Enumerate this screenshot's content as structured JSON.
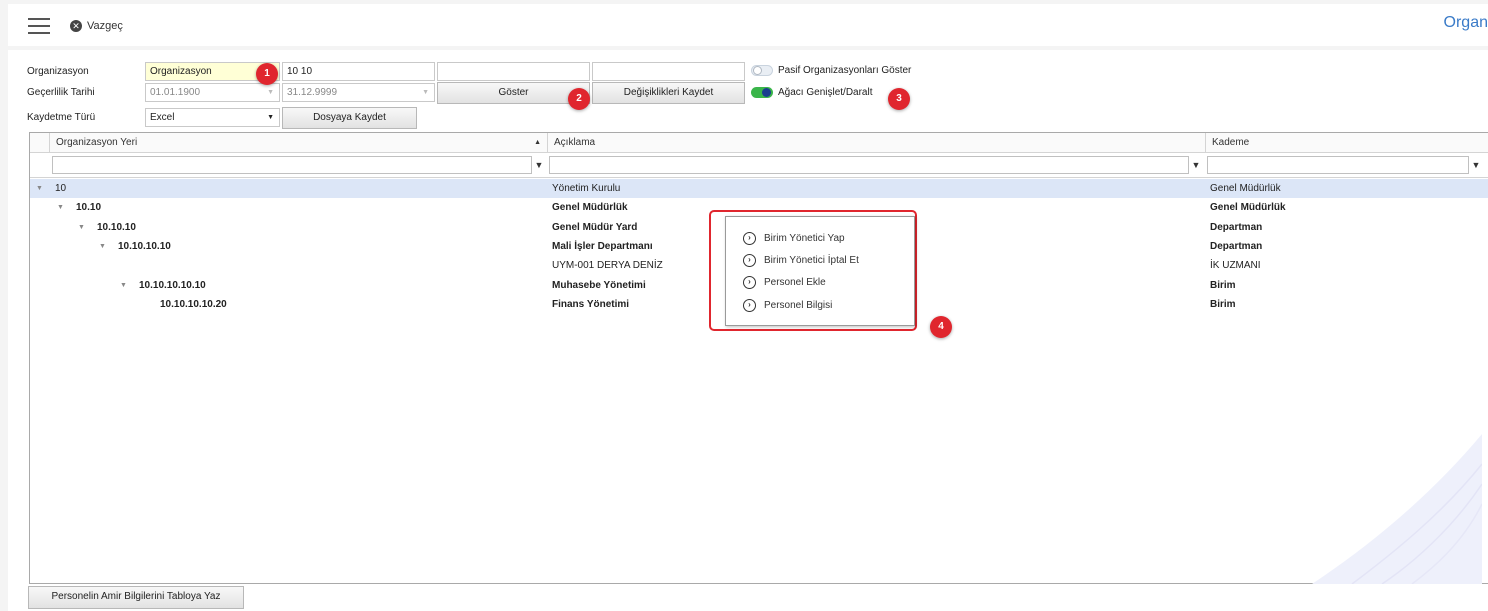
{
  "header": {
    "cancel_label": "Vazgeç",
    "page_title": "Organ"
  },
  "form": {
    "organization_label": "Organizasyon",
    "organization_value": "Organizasyon",
    "organization_code": "10 10",
    "organization_extra1": "",
    "organization_extra2": "",
    "validity_label": "Geçerlilik Tarihi",
    "validity_start": "01.01.1900",
    "validity_end": "31.12.9999",
    "save_type_label": "Kaydetme Türü",
    "save_type_value": "Excel",
    "show_button": "Göster",
    "save_changes_button": "Değişiklikleri Kaydet",
    "save_file_button": "Dosyaya Kaydet",
    "passive_toggle_label": "Pasif Organizasyonları Göster",
    "passive_toggle_on": false,
    "tree_toggle_label": "Ağacı Genişlet/Daralt",
    "tree_toggle_on": true,
    "toggle_on_color": "#3ab54a"
  },
  "badges": [
    "1",
    "2",
    "3",
    "4"
  ],
  "grid": {
    "columns": [
      {
        "label": "Organizasyon Yeri"
      },
      {
        "label": "Açıklama"
      },
      {
        "label": "Kademe"
      }
    ],
    "rows": [
      {
        "place": "10",
        "description": "Yönetim Kurulu",
        "level": "Genel Müdürlük",
        "depth": 0,
        "expand": true,
        "bold": false,
        "selected": true
      },
      {
        "place": "10.10",
        "description": "Genel Müdürlük",
        "level": "Genel Müdürlük",
        "depth": 1,
        "expand": true,
        "bold": true,
        "selected": false
      },
      {
        "place": "10.10.10",
        "description": "Genel Müdür Yard",
        "level": "Departman",
        "depth": 2,
        "expand": true,
        "bold": true,
        "selected": false
      },
      {
        "place": "10.10.10.10",
        "description": "Mali İşler Departmanı",
        "level": "Departman",
        "depth": 3,
        "expand": true,
        "bold": true,
        "selected": false
      },
      {
        "place": "",
        "description": "UYM-001 DERYA DENİZ",
        "level": "İK UZMANI",
        "depth": 4,
        "expand": false,
        "bold": false,
        "selected": false
      },
      {
        "place": "10.10.10.10.10",
        "description": "Muhasebe Yönetimi",
        "level": "Birim",
        "depth": 4,
        "expand": true,
        "bold": true,
        "selected": false
      },
      {
        "place": "10.10.10.10.20",
        "description": "Finans Yönetimi",
        "level": "Birim",
        "depth": 5,
        "expand": false,
        "bold": true,
        "selected": false
      }
    ]
  },
  "context_menu": {
    "items": [
      {
        "label": "Birim Yönetici Yap"
      },
      {
        "label": "Birim Yönetici İptal Et"
      },
      {
        "label": "Personel Ekle"
      },
      {
        "label": "Personel Bilgisi"
      }
    ]
  },
  "footer": {
    "write_button": "Personelin Amir Bilgilerini Tabloya Yaz"
  },
  "colors": {
    "accent": "#3a7bc8",
    "badge": "#e0262e",
    "selected_row": "#dce6f7"
  }
}
